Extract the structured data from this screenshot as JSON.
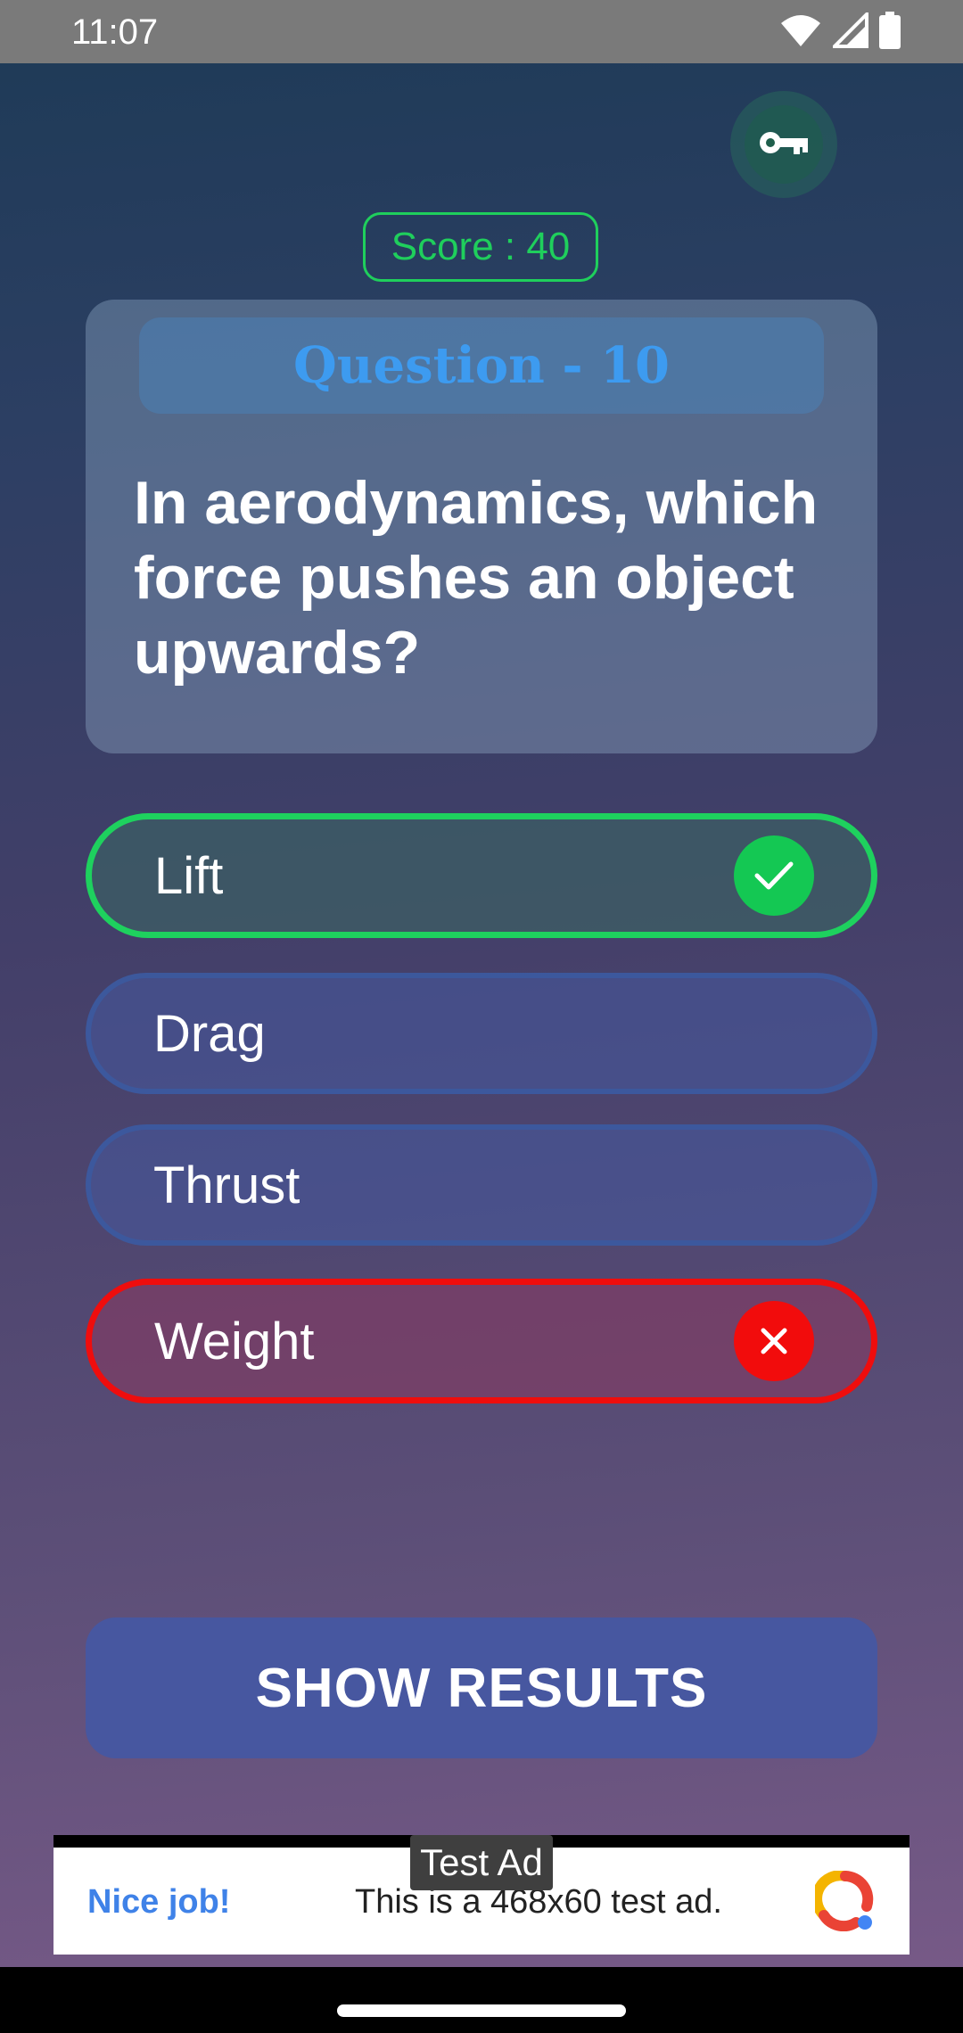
{
  "status_bar": {
    "time": "11:07",
    "icons": [
      "wifi-icon",
      "cell-signal-icon",
      "battery-icon"
    ]
  },
  "hint_button": {
    "icon": "key-icon"
  },
  "score": {
    "label": "Score : 40"
  },
  "question": {
    "header": "Question - 10",
    "text": "In aerodynamics, which force pushes an object upwards?"
  },
  "options": [
    {
      "label": "Lift",
      "state": "correct"
    },
    {
      "label": "Drag",
      "state": "neutral"
    },
    {
      "label": "Thrust",
      "state": "neutral"
    },
    {
      "label": "Weight",
      "state": "wrong"
    }
  ],
  "results_button": {
    "label": "SHOW RESULTS"
  },
  "ad": {
    "label": "Test Ad",
    "title": "Nice job!",
    "body": "This is a 468x60 test ad."
  },
  "colors": {
    "correct": "#1ed15e",
    "wrong": "#ef0d0d",
    "accent": "#3d9bf0",
    "button": "#4757a0"
  }
}
